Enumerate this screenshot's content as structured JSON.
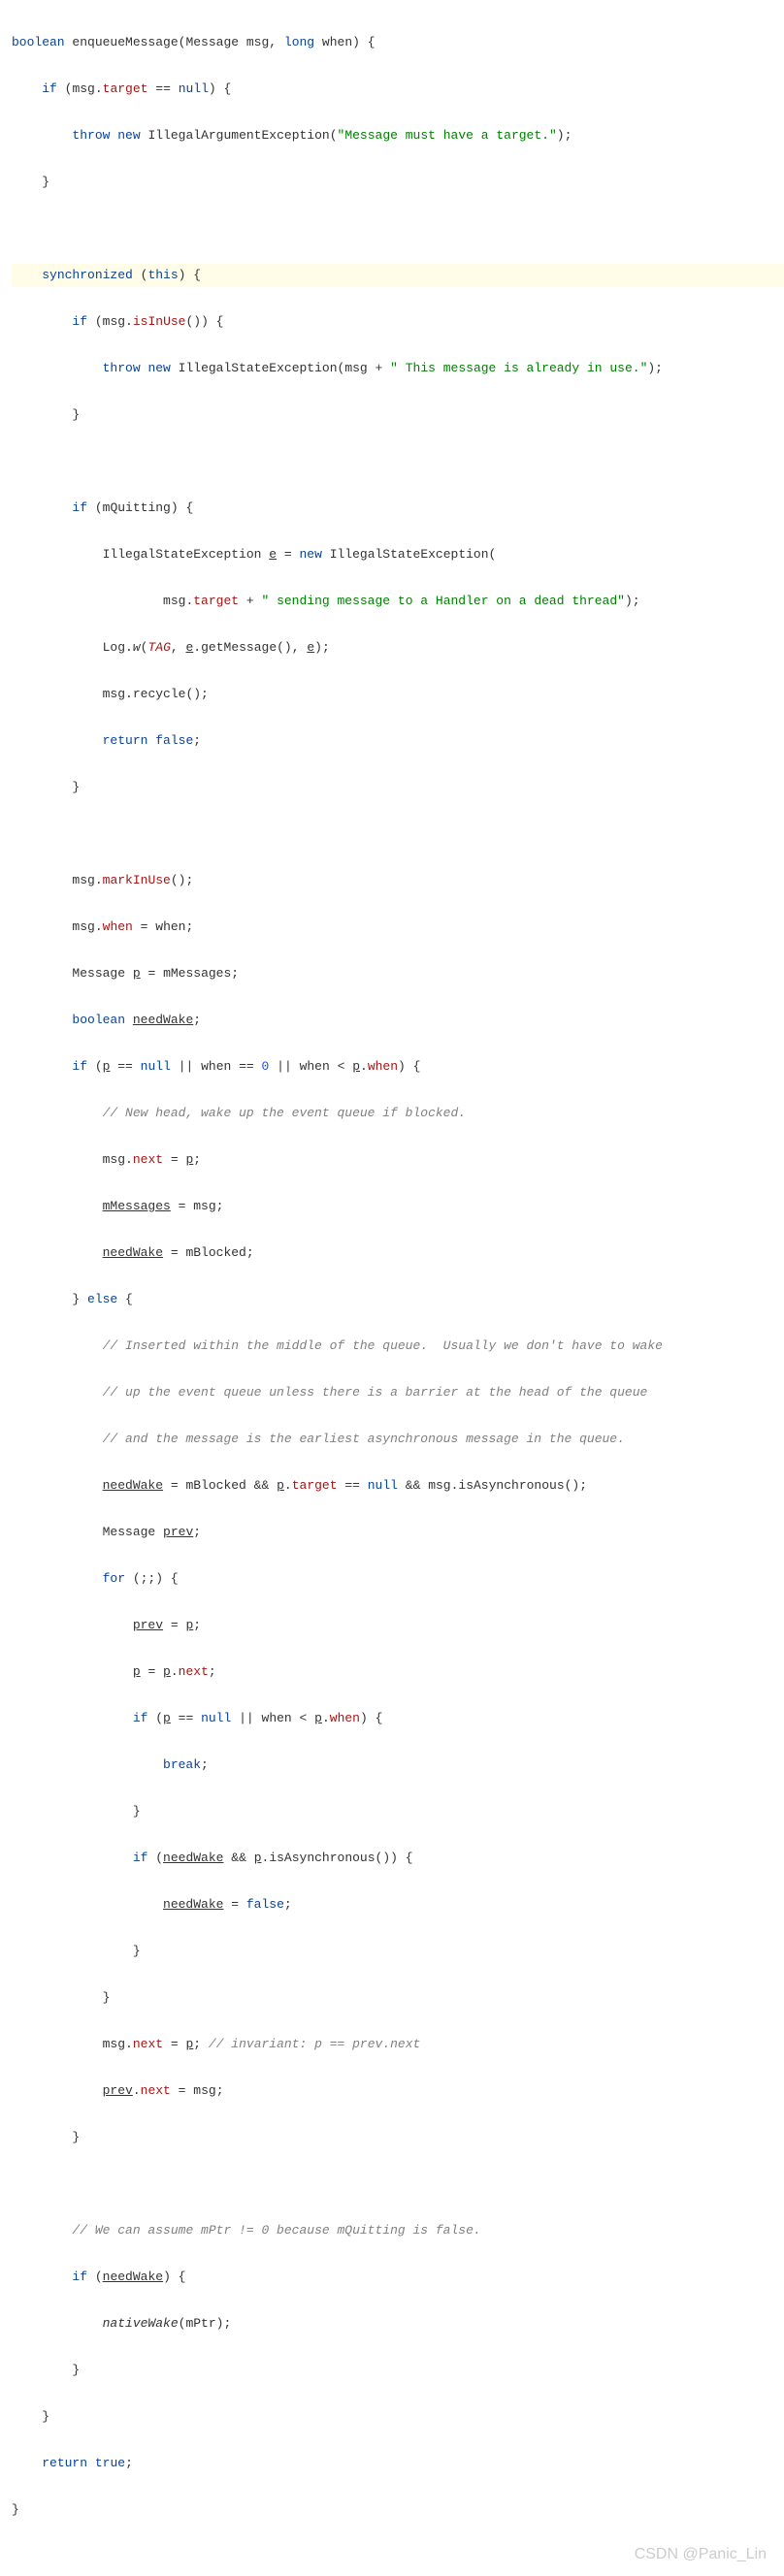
{
  "watermark": "CSDN @Panic_Lin",
  "code": {
    "kw_boolean": "boolean",
    "kw_long": "long",
    "kw_if": "if",
    "kw_throw": "throw",
    "kw_new": "new",
    "kw_synchronized": "synchronized",
    "kw_this": "this",
    "kw_return": "return",
    "kw_false": "false",
    "kw_true": "true",
    "kw_else": "else",
    "kw_for": "for",
    "kw_break": "break",
    "kw_null": "null",
    "fn_enqueueMessage": "enqueueMessage",
    "type_Message": "Message",
    "type_IllegalArgumentException": "IllegalArgumentException",
    "type_IllegalStateException": "IllegalStateException",
    "type_Log": "Log",
    "id_msg": "msg",
    "id_when": "when",
    "id_e": "e",
    "id_p": "p",
    "id_prev": "prev",
    "id_needWake": "needWake",
    "id_mMessages": "mMessages",
    "id_mBlocked": "mBlocked",
    "id_mQuitting": "mQuitting",
    "id_mPtr": "mPtr",
    "id_TAG": "TAG",
    "field_target": "target",
    "field_when": "when",
    "field_next": "next",
    "m_isInUse": "isInUse",
    "m_markInUse": "markInUse",
    "m_recycle": "recycle",
    "m_getMessage": "getMessage",
    "m_isAsynchronous": "isAsynchronous",
    "m_nativeWake": "nativeWake",
    "m_w": "w",
    "str_must_have_target": "\"Message must have a target.\"",
    "str_already_in_use": "\" This message is already in use.\"",
    "str_dead_thread": "\" sending message to a Handler on a dead thread\"",
    "num_0": "0",
    "cmt_new_head": "// New head, wake up the event queue if blocked.",
    "cmt_mid1": "// Inserted within the middle of the queue.  Usually we don't have to wake",
    "cmt_mid2": "// up the event queue unless there is a barrier at the head of the queue",
    "cmt_mid3": "// and the message is the earliest asynchronous message in the queue.",
    "cmt_invariant": "// invariant: p == prev.next",
    "cmt_assume": "// We can assume mPtr != 0 because mQuitting is false."
  }
}
